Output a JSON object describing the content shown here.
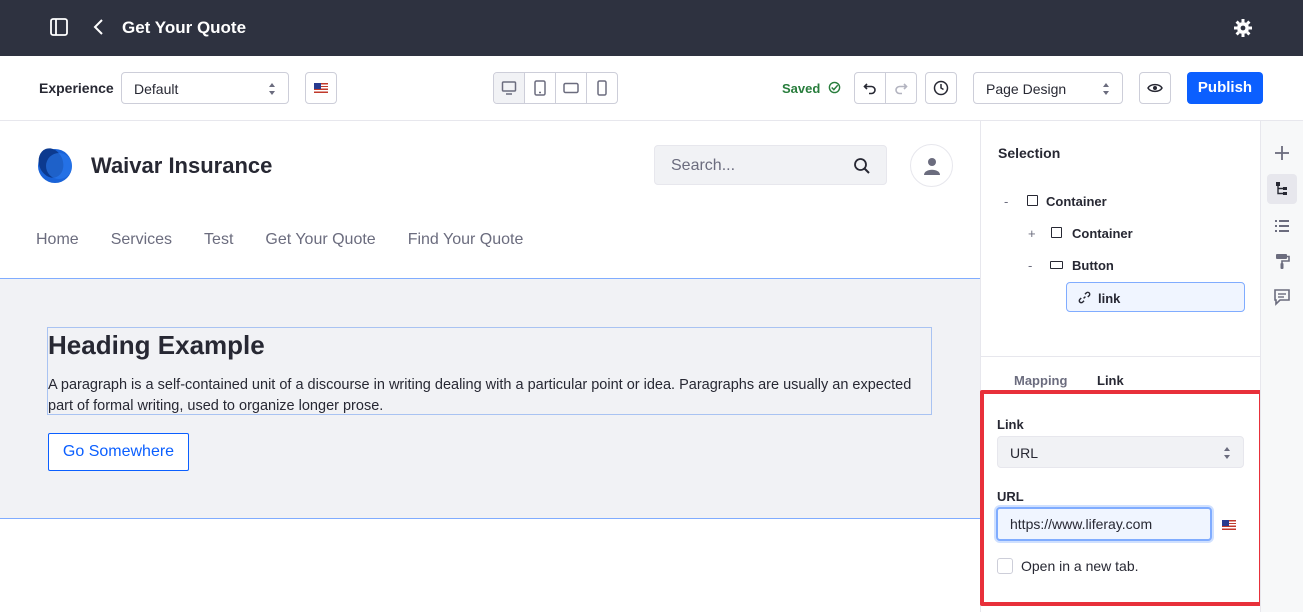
{
  "topbar": {
    "title": "Get Your Quote",
    "icons": [
      "sidebar-toggle-icon",
      "back-chevron-icon",
      "gear-icon"
    ]
  },
  "toolbar": {
    "experience_label": "Experience",
    "experience_value": "Default",
    "language_flag": "us-flag-icon",
    "devices": [
      "desktop-icon",
      "tablet-icon",
      "landscape-icon",
      "mobile-icon"
    ],
    "active_device": "desktop-icon",
    "saved_label": "Saved",
    "page_design_value": "Page Design",
    "publish_label": "Publish"
  },
  "site": {
    "name": "Waivar Insurance",
    "search_placeholder": "Search...",
    "nav": [
      "Home",
      "Services",
      "Test",
      "Get Your Quote",
      "Find Your Quote"
    ]
  },
  "section": {
    "heading": "Heading Example",
    "paragraph": "A paragraph is a self-contained unit of a discourse in writing dealing with a particular point or idea. Paragraphs are usually an expected part of formal writing, used to organize longer prose.",
    "button_label": "Go Somewhere"
  },
  "panel": {
    "title": "Selection",
    "tree": [
      {
        "toggle": "-",
        "label": "Container"
      },
      {
        "toggle": "+",
        "label": "Container"
      },
      {
        "toggle": "-",
        "label": "Button"
      },
      {
        "toggle": "",
        "label": "link"
      }
    ],
    "tabs": [
      "Mapping",
      "Link"
    ],
    "link_label": "Link",
    "link_value": "URL",
    "url_label": "URL",
    "url_value": "https://www.liferay.com",
    "new_tab_label": "Open in a new tab."
  },
  "colors": {
    "accent": "#0b5fff",
    "highlight": "#e8303a",
    "topbar": "#2e3240",
    "saved": "#287d3c"
  }
}
